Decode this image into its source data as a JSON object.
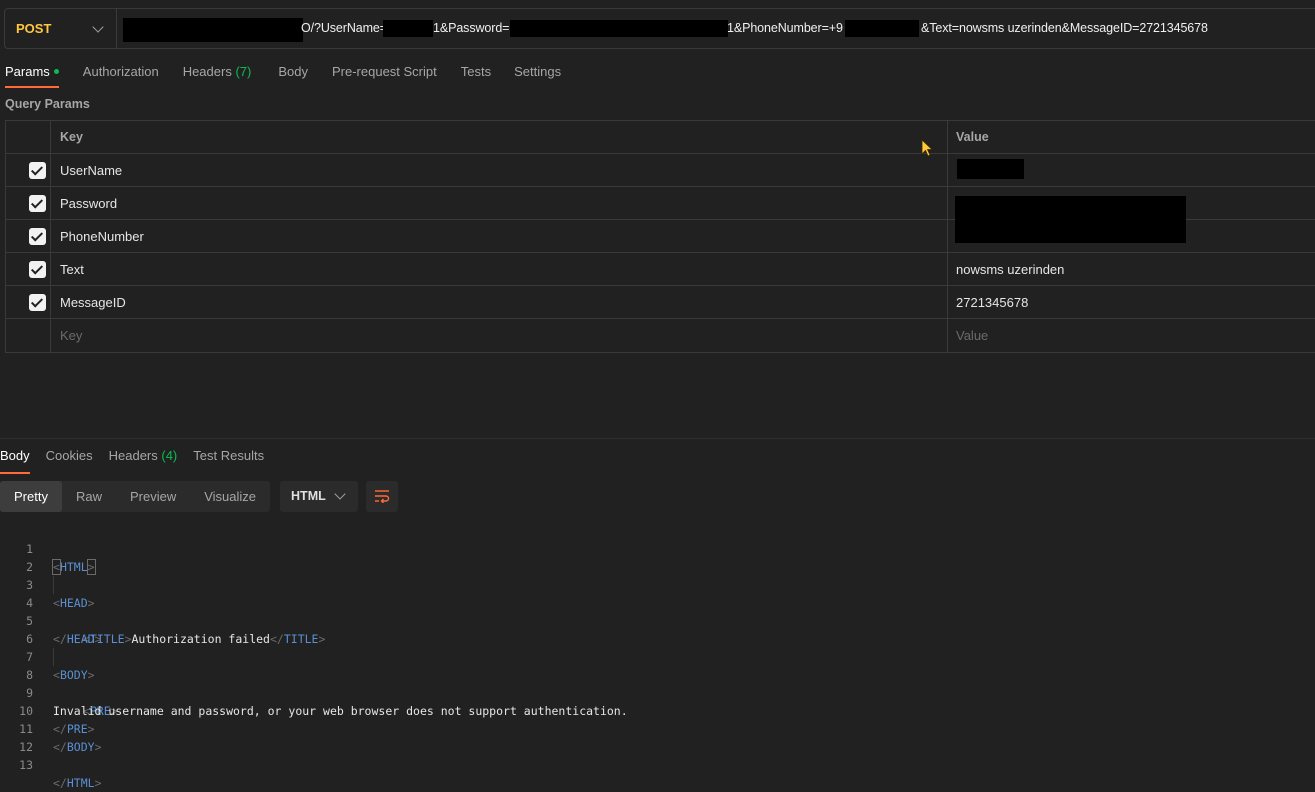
{
  "request": {
    "method": "POST",
    "url_fragments": {
      "f1": "O/?UserName=",
      "f2": "1&Password=",
      "f3": "1&PhoneNumber=+9",
      "f4": "&Text=nowsms uzerinden&MessageID=2721345678"
    }
  },
  "request_tabs": [
    {
      "label": "Params",
      "has_dot": true
    },
    {
      "label": "Authorization"
    },
    {
      "label": "Headers",
      "count": "(7)"
    },
    {
      "label": "Body"
    },
    {
      "label": "Pre-request Script"
    },
    {
      "label": "Tests"
    },
    {
      "label": "Settings"
    }
  ],
  "query_params": {
    "title": "Query Params",
    "key_header": "Key",
    "value_header": "Value",
    "rows": [
      {
        "key": "UserName",
        "value": "",
        "checked": true
      },
      {
        "key": "Password",
        "value": "",
        "checked": true
      },
      {
        "key": "PhoneNumber",
        "value": "",
        "checked": true
      },
      {
        "key": "Text",
        "value": "nowsms uzerinden",
        "checked": true
      },
      {
        "key": "MessageID",
        "value": "2721345678",
        "checked": true
      }
    ],
    "key_placeholder": "Key",
    "value_placeholder": "Value"
  },
  "response_tabs": [
    {
      "label": "Body"
    },
    {
      "label": "Cookies"
    },
    {
      "label": "Headers",
      "count": "(4)"
    },
    {
      "label": "Test Results"
    }
  ],
  "view_modes": [
    "Pretty",
    "Raw",
    "Preview",
    "Visualize"
  ],
  "format": "HTML",
  "code_lines": [
    "1",
    "2",
    "3",
    "4",
    "5",
    "6",
    "7",
    "8",
    "9",
    "10",
    "11",
    "12",
    "13"
  ],
  "code": {
    "html": "HTML",
    "head": "HEAD",
    "title_tag": "TITLE",
    "title_text": "Authorization failed",
    "body": "BODY",
    "pre": "PRE",
    "message": "Invalid username and password, or your web browser does not support authentication."
  },
  "colors": {
    "accent": "#ff6c37",
    "method": "#ffc83d",
    "count_green": "#0cbb52",
    "tag_blue": "#5a8fd1"
  }
}
